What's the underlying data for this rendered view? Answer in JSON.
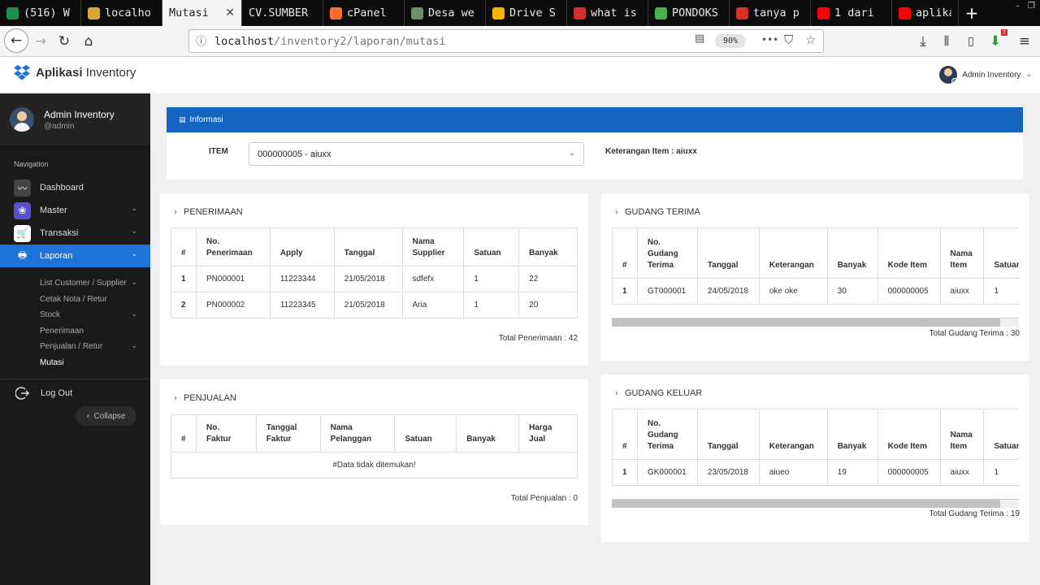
{
  "browser": {
    "tabs": [
      {
        "label": "(516) W",
        "icon_color": "#1b8f4e",
        "icon": "whatsapp-icon"
      },
      {
        "label": "localho",
        "icon_color": "#d6a935",
        "icon": "pma-icon"
      },
      {
        "label": "Mutasi",
        "active": true
      },
      {
        "label": "CV.SUMBER"
      },
      {
        "label": "cPanel",
        "icon_color": "#ff6c2c",
        "icon": "cpanel-icon"
      },
      {
        "label": "Desa we",
        "icon_color": "#6a8f6a",
        "icon": "desa-icon"
      },
      {
        "label": "Drive S",
        "icon_color": "#f4b400",
        "icon": "drive-icon"
      },
      {
        "label": "what is",
        "icon_color": "#d32f2f",
        "icon": "bookmark-icon"
      },
      {
        "label": "PONDOKS",
        "icon_color": "#4caf50",
        "icon": "pondok-icon"
      },
      {
        "label": "tanya p",
        "icon_color": "#d93025",
        "icon": "gmail-icon"
      },
      {
        "label": "1 dari",
        "icon_color": "#ff0000",
        "icon": "youtube-icon"
      },
      {
        "label": "aplikas",
        "icon_color": "#ff0000",
        "icon": "youtube-icon"
      }
    ],
    "new_tab": "+",
    "url_host": "localhost",
    "url_path": "/inventory2/laporan/mutasi",
    "zoom": "90%",
    "more": "•••",
    "notif_badge": "7"
  },
  "app": {
    "brand_bold": "Aplikasi",
    "brand_rest": " Inventory",
    "header_user": "Admin Inventory"
  },
  "sidebar": {
    "user_name": "Admin Inventory",
    "user_handle": "@admin",
    "nav_label": "Navigation",
    "menu": [
      {
        "label": "Dashboard",
        "icon": "pulse-icon",
        "color": "#444"
      },
      {
        "label": "Master",
        "icon": "circles-icon",
        "color": "#5a4fcf",
        "has_sub": true
      },
      {
        "label": "Transaksi",
        "icon": "cart-icon",
        "color": "#ffffff",
        "has_sub": true
      },
      {
        "label": "Laporan",
        "icon": "printer-icon",
        "color": "#1e73d8",
        "has_sub": true,
        "active": true
      }
    ],
    "submenu": [
      {
        "label": "List Customer / Supplier",
        "has_sub": true
      },
      {
        "label": "Cetak Nota / Retur"
      },
      {
        "label": "Stock",
        "has_sub": true
      },
      {
        "label": "Penerimaan"
      },
      {
        "label": "Penjualan / Retur",
        "has_sub": true
      },
      {
        "label": "Mutasi",
        "active": true
      }
    ],
    "logout": "Log Out",
    "collapse": "Collapse"
  },
  "info": {
    "header": "Informasi",
    "item_label": "ITEM",
    "item_value": "000000005 - aiuxx",
    "keterangan": "Keterangan Item : aiuxx"
  },
  "penerimaan": {
    "title": "PENERIMAAN",
    "headers": [
      "#",
      "No.\nPenerimaan",
      "Apply",
      "Tanggal",
      "Nama\nSupplier",
      "Satuan",
      "Banyak"
    ],
    "rows": [
      [
        "1",
        "PN000001",
        "11223344",
        "21/05/2018",
        "sdfefx",
        "1",
        "22"
      ],
      [
        "2",
        "PN000002",
        "11223345",
        "21/05/2018",
        "Aria",
        "1",
        "20"
      ]
    ],
    "total": "Total Penerimaan : 42"
  },
  "penjualan": {
    "title": "PENJUALAN",
    "headers": [
      "#",
      "No.\nFaktur",
      "Tanggal\nFaktur",
      "Nama\nPelanggan",
      "Satuan",
      "Banyak",
      "Harga\nJual"
    ],
    "empty": "#Data tidak ditemukan!",
    "total": "Total Penjualan : 0"
  },
  "gudang_terima": {
    "title": "GUDANG TERIMA",
    "headers": [
      "#",
      "No.\nGudang\nTerima",
      "Tanggal",
      "Keterangan",
      "Banyak",
      "Kode Item",
      "Nama\nItem",
      "Satuan"
    ],
    "rows": [
      [
        "1",
        "GT000001",
        "24/05/2018",
        "oke oke",
        "30",
        "000000005",
        "aiuxx",
        "1"
      ]
    ],
    "total": "Total Gudang Terima : 30"
  },
  "gudang_keluar": {
    "title": "GUDANG KELUAR",
    "headers": [
      "#",
      "No.\nGudang\nTerima",
      "Tanggal",
      "Keterangan",
      "Banyak",
      "Kode Item",
      "Nama\nItem",
      "Satuan"
    ],
    "rows": [
      [
        "1",
        "GK000001",
        "23/05/2018",
        "aiueo",
        "19",
        "000000005",
        "aiuxx",
        "1"
      ]
    ],
    "total": "Total Gudang Terima : 19"
  }
}
